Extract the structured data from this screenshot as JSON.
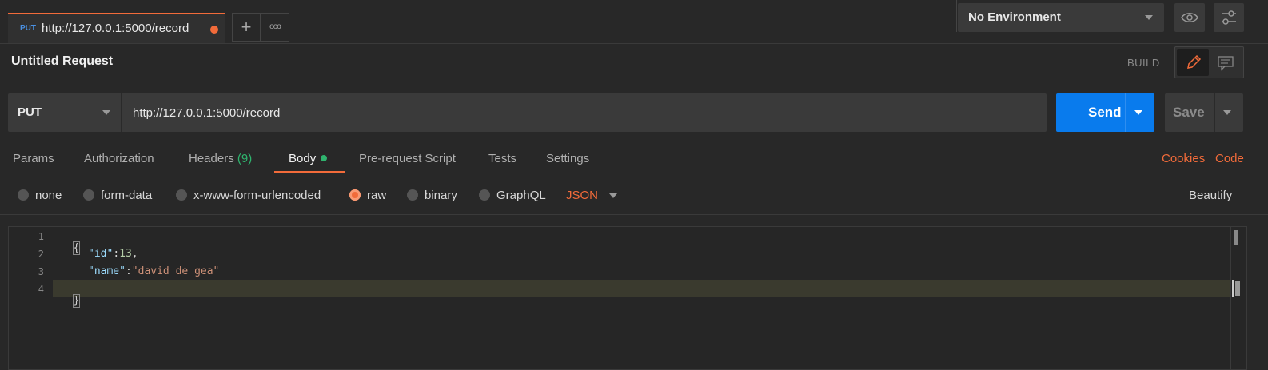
{
  "tab": {
    "method": "PUT",
    "url": "http://127.0.0.1:5000/record",
    "unsaved": true
  },
  "tabs_actions": {
    "add_label": "+",
    "more_label": "ooo"
  },
  "environment": {
    "selected": "No Environment"
  },
  "request": {
    "title": "Untitled Request",
    "mode_label": "BUILD",
    "method": "PUT",
    "url": "http://127.0.0.1:5000/record",
    "send_label": "Send",
    "save_label": "Save"
  },
  "subtabs": {
    "params": "Params",
    "authorization": "Authorization",
    "headers": "Headers",
    "headers_count": "(9)",
    "body": "Body",
    "prerequest": "Pre-request Script",
    "tests": "Tests",
    "settings": "Settings",
    "cookies": "Cookies",
    "code": "Code"
  },
  "body_types": {
    "none": "none",
    "form_data": "form-data",
    "urlencoded": "x-www-form-urlencoded",
    "raw": "raw",
    "binary": "binary",
    "graphql": "GraphQL",
    "selected": "raw",
    "format": "JSON",
    "beautify": "Beautify"
  },
  "editor": {
    "line_numbers": [
      "1",
      "2",
      "3",
      "4"
    ],
    "open_brace": "{",
    "close_brace": "}",
    "line2_key": "\"id\"",
    "line2_colon": ":",
    "line2_value": "13",
    "line2_comma": ",",
    "line3_key": "\"name\"",
    "line3_colon": ":",
    "line3_value": "\"david de gea\""
  },
  "colors": {
    "accent": "#f26b3a",
    "send": "#097bed",
    "method_badge": "#4a90e2",
    "body_dot": "#2fb46e"
  },
  "icons": [
    "plus-icon",
    "more-icon",
    "eye-icon",
    "sliders-icon",
    "pencil-icon",
    "comment-icon",
    "chevron-down-icon"
  ]
}
